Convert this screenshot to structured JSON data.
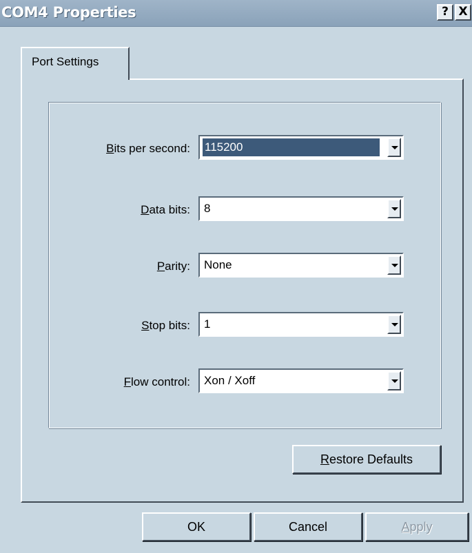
{
  "window": {
    "title": "COM4 Properties",
    "help_label": "?",
    "close_label": "X"
  },
  "tabs": [
    {
      "label": "Port Settings"
    }
  ],
  "fields": [
    {
      "label_key": "B",
      "label_rest": "its per second:",
      "value": "115200",
      "selected": true
    },
    {
      "label_key": "D",
      "label_rest": "ata bits:",
      "value": "8"
    },
    {
      "label_key": "P",
      "label_rest": "arity:",
      "value": "None"
    },
    {
      "label_key": "S",
      "label_rest": "top bits:",
      "value": "1"
    },
    {
      "label_key": "F",
      "label_rest": "low control:",
      "value": "Xon / Xoff"
    }
  ],
  "buttons": {
    "restore_key": "R",
    "restore_rest": "estore Defaults",
    "ok": "OK",
    "cancel": "Cancel",
    "apply_key": "A",
    "apply_rest": "pply"
  }
}
